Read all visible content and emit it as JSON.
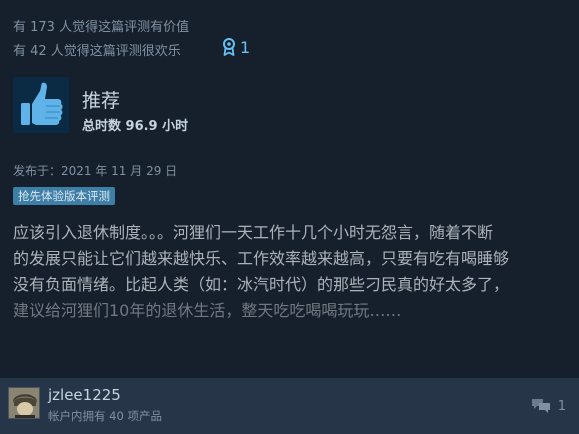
{
  "helpful": {
    "line1": "有 173 人觉得这篇评测有价值",
    "line2": "有 42 人觉得这篇评测很欢乐",
    "awards": "1"
  },
  "review": {
    "verdict": "推荐",
    "hours": "总时数 96.9 小时",
    "posted": "发布于：2021 年 11 月 29 日",
    "badge": "抢先体验版本评测",
    "lines": [
      "应该引入退休制度。。。河狸们一天工作十几个小时无怨言，随着不断",
      "的发展只能让它们越来越快乐、工作效率越来越高，只要有吃有喝睡够",
      "没有负面情绪。比起人类（如：冰汽时代）的那些刁民真的好太多了，",
      "建议给河狸们10年的退休生活，整天吃吃喝喝玩玩……"
    ]
  },
  "author": {
    "name": "jzlee1225",
    "products": "帐户内拥有 40 项产品"
  },
  "comments": {
    "count": "1"
  },
  "colors": {
    "background": "#16202d",
    "accent": "#66c0f4",
    "badge": "#3e7fa8",
    "footer": "#263648"
  },
  "icons": {
    "award": "award-icon",
    "thumb": "thumbs-up-icon",
    "comment": "comment-icon"
  }
}
